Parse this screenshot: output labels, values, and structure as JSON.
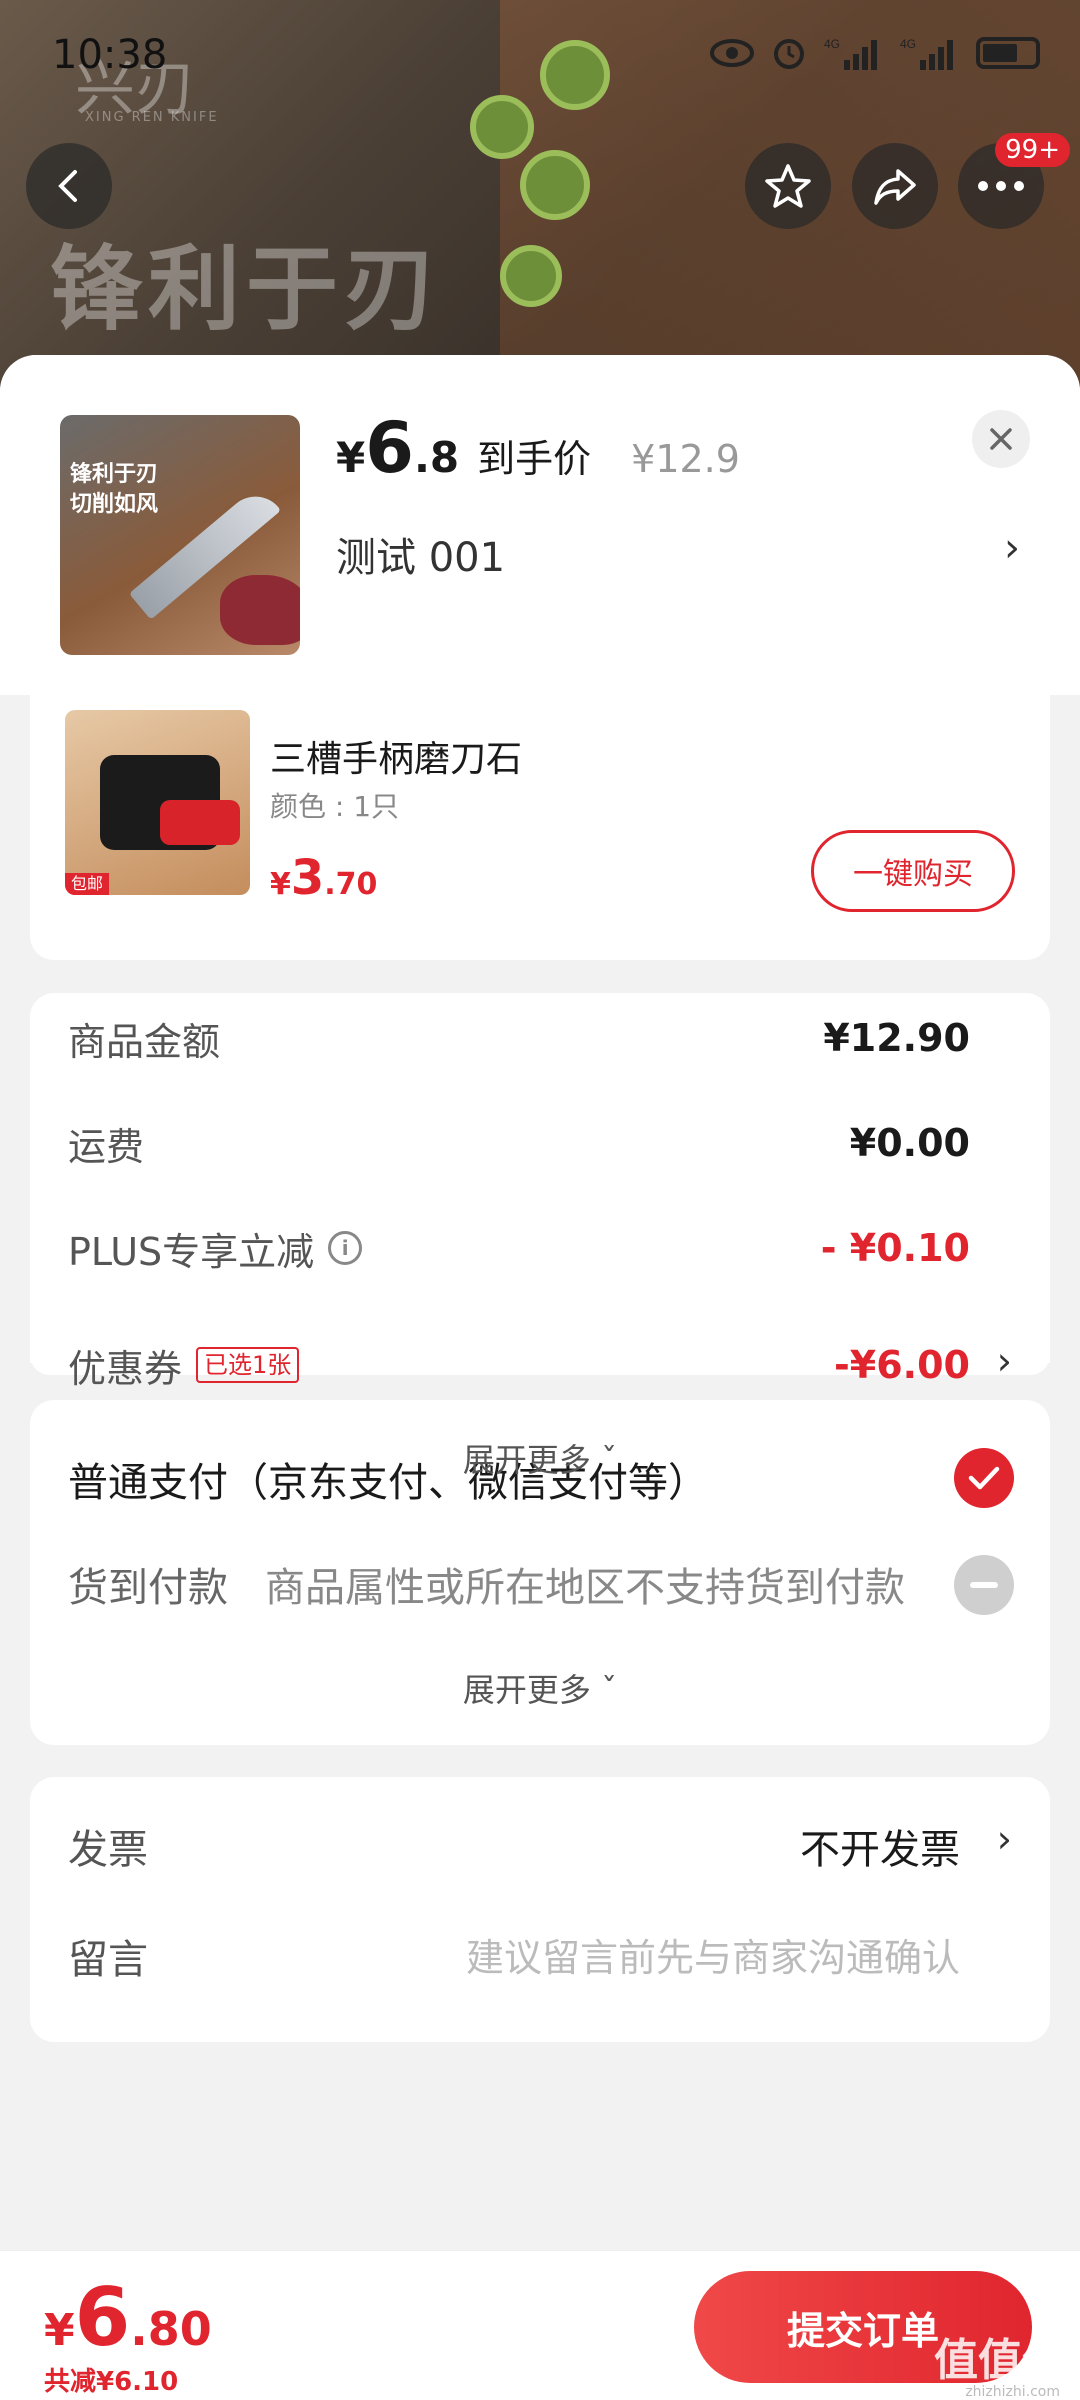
{
  "status_bar": {
    "time": "10:38",
    "net1": "4G",
    "net2": "4G"
  },
  "hero": {
    "brand": "兴刃",
    "brand_sub": "XING REN KNIFE",
    "slogan": "锋利于刃",
    "more_badge": "99+"
  },
  "product": {
    "price_symbol": "¥",
    "price_int": "6",
    "price_dec": ".8",
    "price_label": "到手价",
    "original_price": "¥12.9",
    "variant": "测试  001",
    "thumb_text1": "锋利于刃",
    "thumb_text2": "切削如风"
  },
  "addon": {
    "title": "三槽手柄磨刀石",
    "spec": "颜色 : 1只",
    "price_symbol": "¥",
    "price_int": "3",
    "price_dec": ".70",
    "tag": "包邮",
    "buy_label": "一键购买"
  },
  "summary": {
    "goods_label": "商品金额",
    "goods_value": "¥12.90",
    "shipping_label": "运费",
    "shipping_value": "¥0.00",
    "plus_label": "PLUS专享立减",
    "plus_value": "- ¥0.10",
    "coupon_label": "优惠券",
    "coupon_chip": "已选1张",
    "coupon_value": "-¥6.00",
    "expand_label": "展开更多"
  },
  "payment": {
    "normal_label": "普通支付（京东支付、微信支付等）",
    "cod_label": "货到付款",
    "cod_note": "商品属性或所在地区不支持货到付款",
    "expand_label": "展开更多"
  },
  "extras": {
    "invoice_label": "发票",
    "invoice_value": "不开发票",
    "message_label": "留言",
    "message_placeholder": "建议留言前先与商家沟通确认"
  },
  "footer": {
    "total_symbol": "¥",
    "total_int": "6",
    "total_dec": ".80",
    "saved": "共减¥6.10",
    "submit_label": "提交订单",
    "watermark": "值值值",
    "watermark_url": "zhizhizhi.com"
  },
  "colors": {
    "accent": "#e0252e"
  }
}
